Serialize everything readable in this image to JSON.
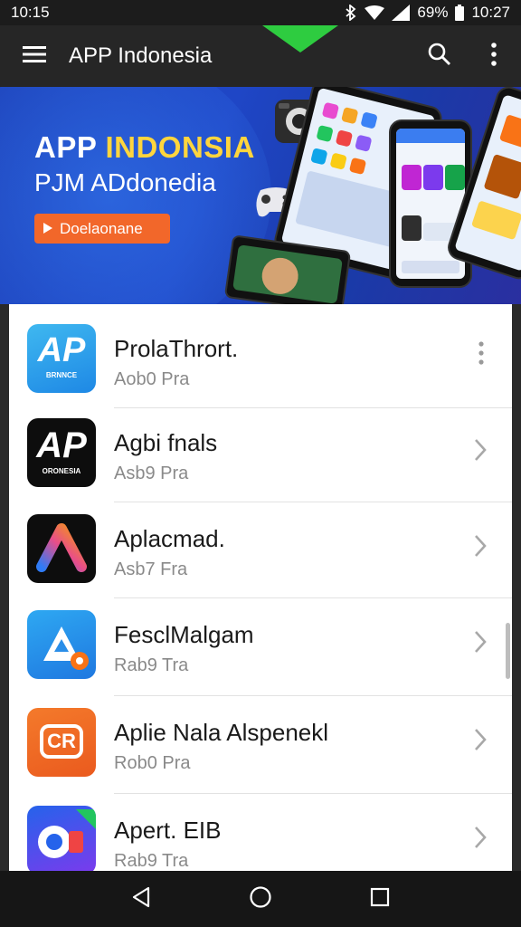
{
  "status_bar": {
    "time_left": "10:15",
    "battery": "69%",
    "time_right": "10:27"
  },
  "app_bar": {
    "title": "APP Indonesia",
    "icons": [
      "menu-icon",
      "search-icon",
      "more-vert-icon"
    ]
  },
  "banner": {
    "headline_part1": "APP ",
    "headline_part2": "INDONSIA",
    "subline": "PJM ADdonedia",
    "cta_label": "Doelaonane"
  },
  "apps": [
    {
      "name": "ProlaThrort.",
      "sub": "Aob0 Pra",
      "trailing": "more",
      "icon_text": "AP",
      "icon_caption": "BRNNCE"
    },
    {
      "name": "Agbi fnals",
      "sub": "Asb9 Pra",
      "trailing": "chevron",
      "icon_text": "AP",
      "icon_caption": "ORONESIA"
    },
    {
      "name": "Aplacmad.",
      "sub": "Asb7 Fra",
      "trailing": "chevron"
    },
    {
      "name": "FesclMalgam",
      "sub": "Rab9 Tra",
      "trailing": "chevron"
    },
    {
      "name": "Aplie Nala Alspenekl",
      "sub": "Rob0 Pra",
      "trailing": "chevron",
      "icon_text": "CR"
    },
    {
      "name": "Apert. EIB",
      "sub": "Rab9 Tra",
      "trailing": "chevron"
    }
  ],
  "colors": {
    "app_bar": "#262626",
    "banner_blue": "#1f46c6",
    "headline_yellow": "#ffd53d",
    "cta_orange": "#f2672a",
    "accent_green": "#2ecc40"
  }
}
